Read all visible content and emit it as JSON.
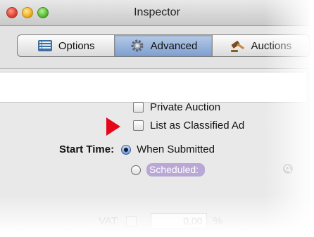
{
  "window": {
    "title": "Inspector"
  },
  "tabs": [
    {
      "label": "Options",
      "icon": "list-icon",
      "selected": false
    },
    {
      "label": "Advanced",
      "icon": "gear-icon",
      "selected": true
    },
    {
      "label": "Auctions",
      "icon": "gavel-icon",
      "selected": false
    }
  ],
  "form": {
    "private_auction_label": "Private Auction",
    "classified_ad_label": "List as Classified Ad",
    "start_time_label": "Start Time:",
    "when_submitted_label": "When Submitted",
    "scheduled_label": "Scheduled:",
    "vat_label": "VAT:",
    "vat_value": "0,00",
    "vat_unit": "%"
  },
  "colors": {
    "arrow": "#e4091a",
    "selected_tab": "#8fabd8",
    "scheduled_pill": "#b9a8d6"
  }
}
